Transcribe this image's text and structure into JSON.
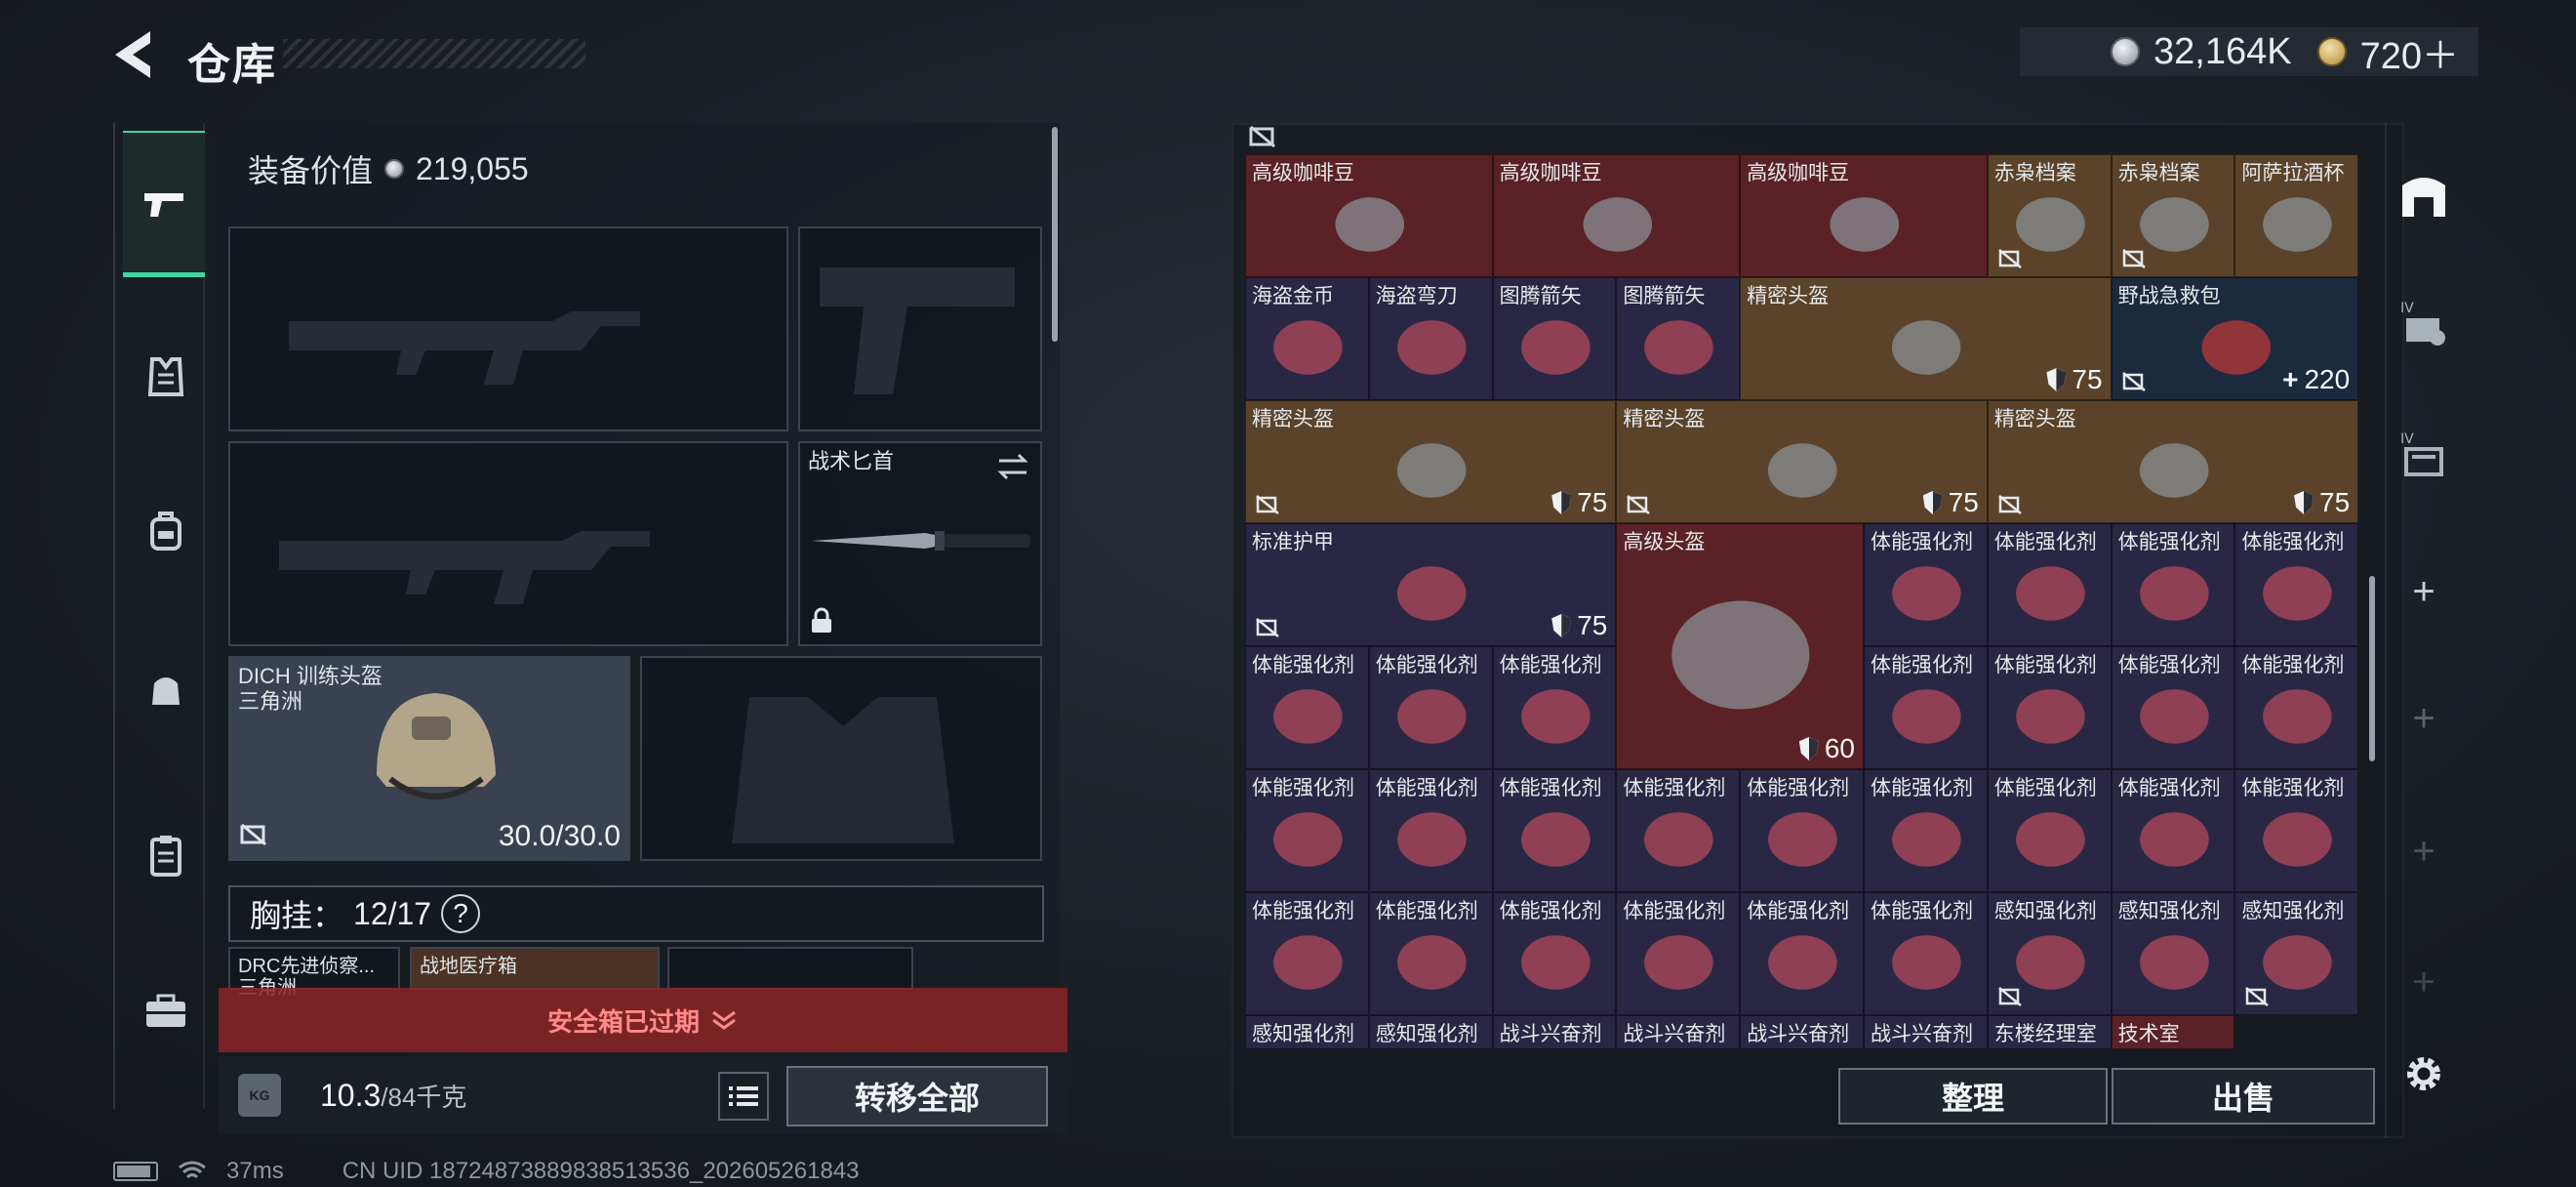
{
  "header": {
    "title": "仓库",
    "currency_silver": "32,164K",
    "currency_gold": "720＋"
  },
  "left_rail": [
    "weapon-icon",
    "armor-vest-icon",
    "backpack-icon",
    "pouch-icon",
    "clipboard-icon",
    "briefcase-icon"
  ],
  "loadout": {
    "equip_value_label": "装备价值",
    "equip_value": "219,055",
    "knife_label": "战术匕首",
    "helmet_label": "DICH 训练头盔",
    "helmet_sub": "三角洲",
    "helmet_durability": "30.0/30.0",
    "rig_label": "胸挂：",
    "rig_capacity": "12/17",
    "help": "?",
    "rig_item_1": "DRC先进侦察...",
    "rig_item_1_sub": "三角洲",
    "rig_item_2": "战地医疗箱",
    "safe_box_text": "安全箱已过期",
    "weight_icon_text": "KG",
    "weight_value": "10.3",
    "weight_cap": "/84千克",
    "transfer_all": "转移全部"
  },
  "storage": {
    "rows": [
      [
        {
          "name": "高级咖啡豆",
          "color": "red",
          "w": 2,
          "h": 1
        },
        {
          "name": "高级咖啡豆",
          "color": "red",
          "w": 2,
          "h": 1
        },
        {
          "name": "高级咖啡豆",
          "color": "red",
          "w": 2,
          "h": 1
        },
        {
          "name": "赤枭档案",
          "color": "gold",
          "w": 1,
          "h": 1,
          "bind": true
        },
        {
          "name": "赤枭档案",
          "color": "gold",
          "w": 1,
          "h": 1,
          "bind": true
        },
        {
          "name": "阿萨拉酒杯",
          "color": "gold",
          "w": 1,
          "h": 1
        }
      ]
    ],
    "items": [
      {
        "name": "高级咖啡豆",
        "color": "red"
      },
      {
        "name": "海盗金币",
        "color": "purple"
      },
      {
        "name": "海盗弯刀",
        "color": "purple"
      },
      {
        "name": "图腾箭矢",
        "color": "purple"
      },
      {
        "name": "图腾箭矢",
        "color": "purple"
      },
      {
        "name": "精密头盔",
        "color": "gold",
        "count": "75"
      },
      {
        "name": "野战急救包",
        "color": "blue",
        "count": "220"
      },
      {
        "name": "标准护甲",
        "color": "purple",
        "count": "75"
      },
      {
        "name": "高级头盔",
        "color": "red",
        "count": "60"
      },
      {
        "name": "体能强化剂",
        "color": "purple"
      },
      {
        "name": "感知强化剂",
        "color": "purple"
      },
      {
        "name": "战斗兴奋剂",
        "color": "purple"
      },
      {
        "name": "东楼经理室",
        "color": "purple"
      },
      {
        "name": "技术室",
        "color": "red"
      }
    ],
    "sort_label": "整理",
    "sell_label": "出售"
  },
  "status": {
    "ping": "37ms",
    "uid": "CN UID 18724873889838513536_202605261843"
  },
  "colors": {
    "accent": "#3fd6a0",
    "red_tier": "#5a2226",
    "gold_tier": "#5a432a",
    "purple_tier": "#2a2744",
    "blue_tier": "#1c2a3e",
    "warning": "#ff8a8a"
  }
}
